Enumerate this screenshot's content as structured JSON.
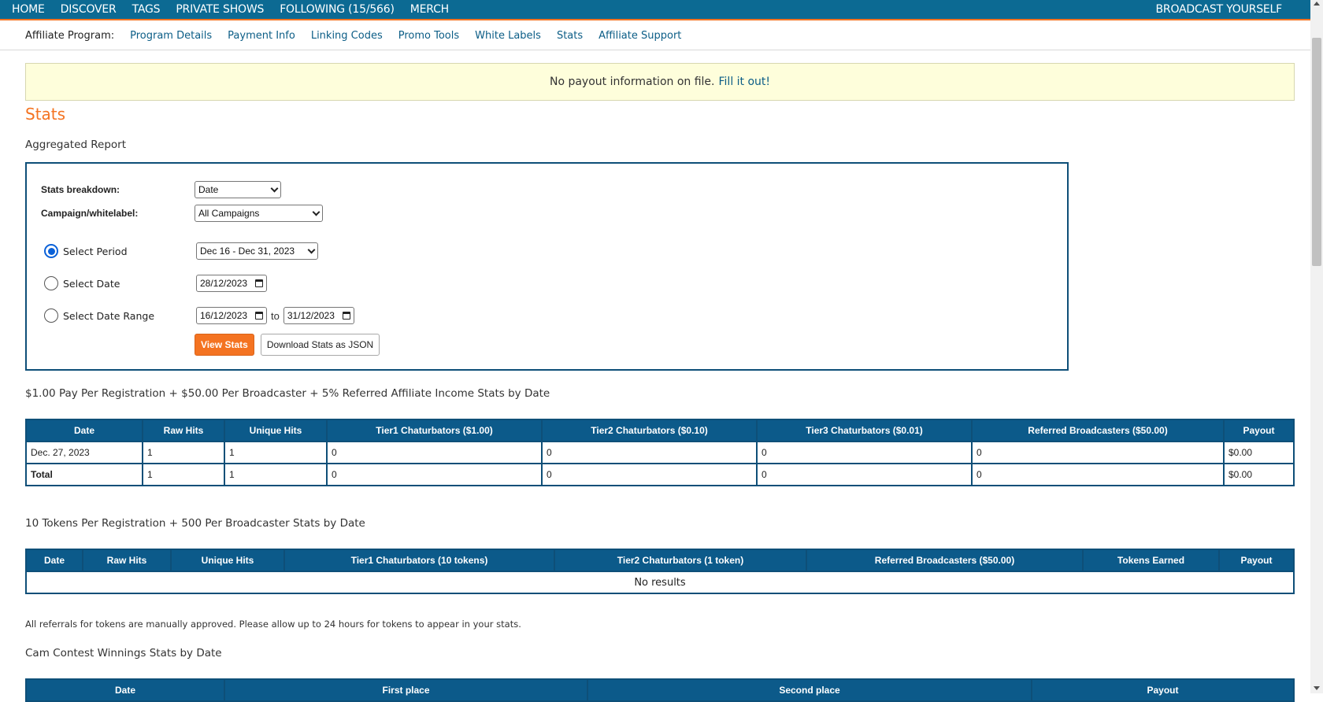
{
  "topnav": {
    "items": [
      "HOME",
      "DISCOVER",
      "TAGS",
      "PRIVATE SHOWS",
      "FOLLOWING (15/566)",
      "MERCH"
    ],
    "broadcast": "BROADCAST YOURSELF"
  },
  "subnav": {
    "label": "Affiliate Program:",
    "links": [
      "Program Details",
      "Payment Info",
      "Linking Codes",
      "Promo Tools",
      "White Labels",
      "Stats",
      "Affiliate Support"
    ]
  },
  "notice": {
    "text": "No payout information on file.",
    "link": "Fill it out!"
  },
  "page_title": "Stats",
  "aggregated_title": "Aggregated Report",
  "form": {
    "breakdown_label": "Stats breakdown:",
    "breakdown_value": "Date",
    "campaign_label": "Campaign/whitelabel:",
    "campaign_value": "All Campaigns",
    "period_label": "Select Period",
    "period_value": "Dec 16 - Dec 31, 2023",
    "date_label": "Select Date",
    "date_value": "28/12/2023",
    "range_label": "Select Date Range",
    "range_from": "16/12/2023",
    "range_to_word": "to",
    "range_to": "31/12/2023",
    "view_button": "View Stats",
    "download_button": "Download Stats as JSON"
  },
  "table1": {
    "title": "$1.00 Pay Per Registration + $50.00 Per Broadcaster + 5% Referred Affiliate Income Stats by Date",
    "headers": [
      "Date",
      "Raw Hits",
      "Unique Hits",
      "Tier1 Chaturbators ($1.00)",
      "Tier2 Chaturbators ($0.10)",
      "Tier3 Chaturbators ($0.01)",
      "Referred Broadcasters ($50.00)",
      "Payout"
    ],
    "rows": [
      [
        "Dec. 27, 2023",
        "1",
        "1",
        "0",
        "0",
        "0",
        "0",
        "$0.00"
      ],
      [
        "Total",
        "1",
        "1",
        "0",
        "0",
        "0",
        "0",
        "$0.00"
      ]
    ]
  },
  "table2": {
    "title": "10 Tokens Per Registration + 500 Per Broadcaster Stats by Date",
    "headers": [
      "Date",
      "Raw Hits",
      "Unique Hits",
      "Tier1 Chaturbators (10 tokens)",
      "Tier2 Chaturbators (1 token)",
      "Referred Broadcasters ($50.00)",
      "Tokens Earned",
      "Payout"
    ],
    "no_results": "No results"
  },
  "note": "All referrals for tokens are manually approved. Please allow up to 24 hours for tokens to appear in your stats.",
  "table3": {
    "title": "Cam Contest Winnings Stats by Date",
    "headers": [
      "Date",
      "First place",
      "Second place",
      "Payout"
    ]
  },
  "colors": {
    "nav": "#0c6a93",
    "accent": "#f47321",
    "table_header": "#0c5a8a",
    "notice_bg": "#fefedb"
  }
}
